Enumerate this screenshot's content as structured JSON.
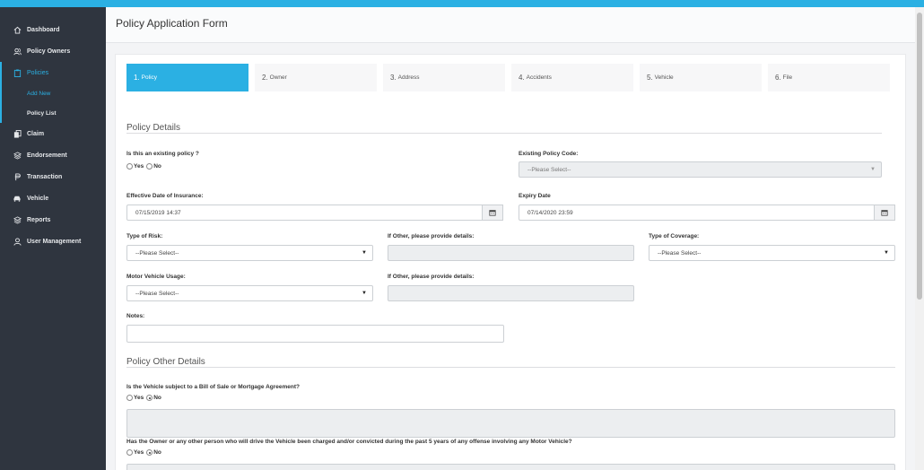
{
  "sidebar": {
    "items": [
      {
        "label": "Dashboard",
        "icon": "home-icon"
      },
      {
        "label": "Policy Owners",
        "icon": "users-icon"
      },
      {
        "label": "Policies",
        "icon": "clipboard-icon"
      },
      {
        "label": "Add New"
      },
      {
        "label": "Policy List"
      },
      {
        "label": "Claim",
        "icon": "copy-icon"
      },
      {
        "label": "Endorsement",
        "icon": "layers-icon"
      },
      {
        "label": "Transaction",
        "icon": "currency-icon"
      },
      {
        "label": "Vehicle",
        "icon": "car-icon"
      },
      {
        "label": "Reports",
        "icon": "layers-icon"
      },
      {
        "label": "User Management",
        "icon": "user-icon"
      }
    ]
  },
  "header": {
    "title": "Policy Application Form"
  },
  "steps": [
    {
      "num": "1.",
      "label": "Policy"
    },
    {
      "num": "2.",
      "label": "Owner"
    },
    {
      "num": "3.",
      "label": "Address"
    },
    {
      "num": "4.",
      "label": "Accidents"
    },
    {
      "num": "5.",
      "label": "Vehicle"
    },
    {
      "num": "6.",
      "label": "File"
    }
  ],
  "policy_details": {
    "title": "Policy Details",
    "existing_question": "Is this an existing policy ?",
    "yes": "Yes",
    "no": "No",
    "existing_code_label": "Existing Policy Code:",
    "existing_code_value": "--Please Select--",
    "effective_label": "Effective Date of Insurance:",
    "effective_value": "07/15/2019 14:37",
    "expiry_label": "Expiry Date",
    "expiry_value": "07/14/2020 23:59",
    "risk_label": "Type of Risk:",
    "risk_value": "--Please Select--",
    "other_label_1": "If Other, please provide details:",
    "coverage_label": "Type of Coverage:",
    "coverage_value": "--Please Select--",
    "usage_label": "Motor Vehicle Usage:",
    "usage_value": "--Please Select--",
    "other_label_2": "If Other, please provide details:",
    "notes_label": "Notes:"
  },
  "other_details": {
    "title": "Policy Other Details",
    "q1": "Is the Vehicle subject to a Bill of Sale or Mortgage Agreement?",
    "q2": "Has the Owner or any other person who will drive the Vehicle been charged and/or convicted during the past 5 years of any offense involving any Motor Vehicle?",
    "yes": "Yes",
    "no": "No"
  },
  "colors": {
    "accent": "#2bb0e3",
    "sidebar": "#2f353f"
  }
}
